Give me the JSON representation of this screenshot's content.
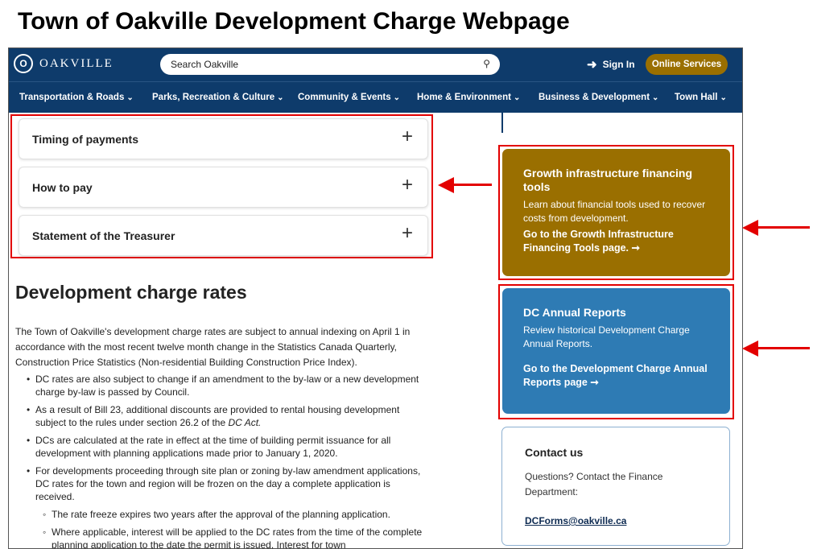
{
  "caption": "Town of Oakville Development Charge Webpage",
  "header": {
    "logo_mark": "O",
    "logo_text": "OAKVILLE",
    "search_placeholder": "Search Oakville",
    "sign_in": "Sign In",
    "online_services": "Online Services"
  },
  "nav": [
    "Transportation & Roads",
    "Parks, Recreation & Culture",
    "Community & Events",
    "Home & Environment",
    "Business & Development",
    "Town Hall"
  ],
  "accordion": [
    "Timing of payments",
    "How to pay",
    "Statement of the Treasurer"
  ],
  "main": {
    "heading": "Development charge rates",
    "intro": "The Town of Oakville's development charge rates are subject to annual indexing on April 1 in accordance with the most recent twelve month change in the Statistics Canada Quarterly, Construction Price Statistics (Non-residential Building Construction Price Index).",
    "bullets": [
      "DC rates are also subject to change if an amendment to the by-law or a new development charge by-law is passed by Council.",
      "As a result of Bill 23, additional discounts are provided to rental housing development subject to the rules under section 26.2 of the",
      "DCs are calculated at the rate in effect at the time of building permit issuance for all development with planning applications made prior to January 1, 2020.",
      "For developments proceeding through site plan or zoning by-law amendment applications, DC rates for the town and region will be frozen on the day a complete application is received."
    ],
    "bullet2_italic": "DC Act.",
    "subbullets": [
      "The rate freeze expires two years after the approval of the planning application.",
      "Where applicable, interest will be applied to the DC rates from the time of the complete planning application to the date the permit is issued. Interest for town"
    ]
  },
  "cards": {
    "growth": {
      "title": "Growth infrastructure financing tools",
      "desc": "Learn about financial tools used to recover costs from development.",
      "link": "Go to the Growth Infrastructure Financing Tools page. ➞",
      "color": "#9a6f00"
    },
    "dc": {
      "title": "DC Annual Reports",
      "desc": "Review historical Development Charge Annual Reports.",
      "link": "Go to the Development Charge Annual Reports page ➞",
      "color": "#2e7bb4"
    }
  },
  "contact": {
    "title": "Contact us",
    "text": "Questions? Contact the Finance Department:",
    "email": "DCForms@oakville.ca"
  },
  "colors": {
    "navy": "#0e3b6b",
    "gold": "#9a6f00",
    "annotation_red": "#e30000"
  }
}
